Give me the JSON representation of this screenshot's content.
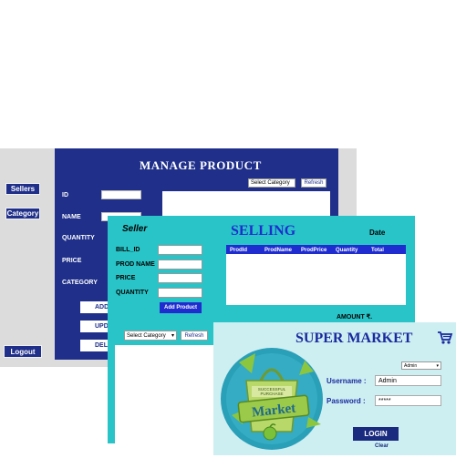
{
  "manage_product": {
    "title": "MANAGE PRODUCT",
    "sidebar": {
      "sellers": "Sellers",
      "category": "Category",
      "logout": "Logout"
    },
    "labels": {
      "id": "ID",
      "name": "NAME",
      "quantity": "QUANTITY",
      "price": "PRICE",
      "category": "CATEGORY"
    },
    "buttons": {
      "add": "ADD",
      "update": "UPDATE",
      "delete": "DELETE"
    },
    "select_category": "Select Category",
    "refresh": "Refresh"
  },
  "selling": {
    "seller": "Seller",
    "title": "SELLING",
    "date_label": "Date",
    "labels": {
      "bill_id": "BILL_ID",
      "prod_name": "PROD NAME",
      "price": "PRICE",
      "quantity": "QUANTITY"
    },
    "add_product": "Add Product",
    "columns": [
      "ProdId",
      "ProdName",
      "ProdPrice",
      "Quantity",
      "Total"
    ],
    "amount_label": "AMOUNT ₹.",
    "select_category": "Select Category",
    "refresh": "Refresh"
  },
  "login": {
    "title": "SUPER MARKET",
    "role_selected": "Admin",
    "username_label": "Username :",
    "username_value": "Admin",
    "password_label": "Password :",
    "password_value": "*****",
    "login_button": "LOGIN",
    "clear": "Clear",
    "logo": {
      "banner": "SUCCESSFUL PURCHASE",
      "word": "Market"
    }
  },
  "colors": {
    "navy": "#1f2f8a",
    "teal": "#29c4c8",
    "blue": "#1f2ccf",
    "login_bg": "#cdeff2",
    "logo_green": "#8cc63f"
  }
}
